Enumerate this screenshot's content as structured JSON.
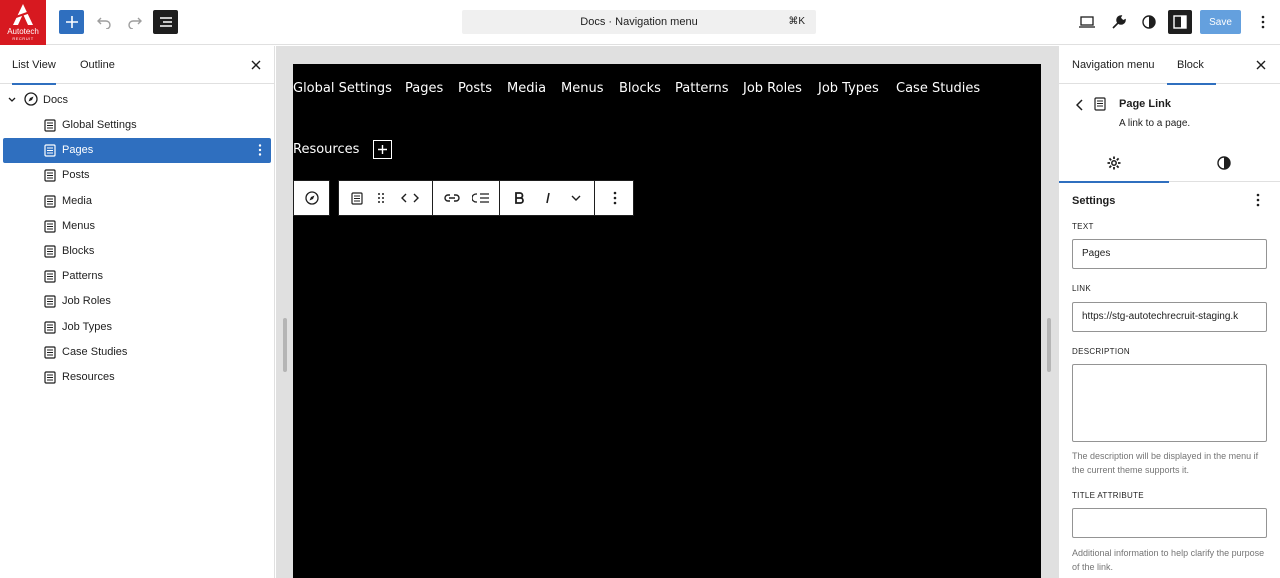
{
  "logo": {
    "brand": "Autotech",
    "sub": "RECRUIT"
  },
  "command": {
    "title": "Docs · Navigation menu",
    "shortcut": "⌘K"
  },
  "topbar": {
    "save_label": "Save"
  },
  "left_panel": {
    "tabs": [
      {
        "label": "List View"
      },
      {
        "label": "Outline"
      }
    ],
    "root_label": "Docs",
    "items": [
      {
        "label": "Global Settings"
      },
      {
        "label": "Pages"
      },
      {
        "label": "Posts"
      },
      {
        "label": "Media"
      },
      {
        "label": "Menus"
      },
      {
        "label": "Blocks"
      },
      {
        "label": "Patterns"
      },
      {
        "label": "Job Roles"
      },
      {
        "label": "Job Types"
      },
      {
        "label": "Case Studies"
      },
      {
        "label": "Resources"
      }
    ],
    "selected_index": 1
  },
  "canvas": {
    "nav_items": [
      {
        "label": "Global Settings"
      },
      {
        "label": "Pages"
      },
      {
        "label": "Posts"
      },
      {
        "label": "Media"
      },
      {
        "label": "Menus"
      },
      {
        "label": "Blocks"
      },
      {
        "label": "Patterns"
      },
      {
        "label": "Job Roles"
      },
      {
        "label": "Job Types"
      },
      {
        "label": "Case Studies"
      }
    ],
    "resources": "Resources"
  },
  "right_panel": {
    "tabs": [
      {
        "label": "Navigation menu"
      },
      {
        "label": "Block"
      }
    ],
    "block_title": "Page Link",
    "block_desc": "A link to a page.",
    "settings_title": "Settings",
    "fields": {
      "text_label": "Text",
      "text_value": "Pages",
      "link_label": "Link",
      "link_value": "https://stg-autotechrecruit-staging.k",
      "description_label": "Description",
      "description_help": "The description will be displayed in the menu if the current theme supports it.",
      "title_attr_label": "Title Attribute",
      "title_attr_help": "Additional information to help clarify the purpose of the link."
    }
  },
  "colors": {
    "accent": "#2f6fbf",
    "brand": "#d71920",
    "canvas": "#000000"
  }
}
